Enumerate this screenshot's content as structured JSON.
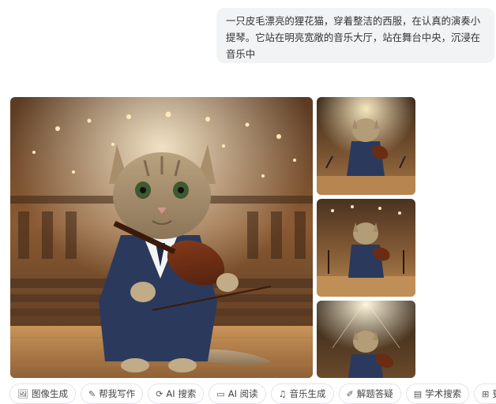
{
  "prompt": {
    "text": "一只皮毛漂亮的狸花猫，穿着整洁的西服，在认真的演奏小提琴。它站在明亮宽敞的音乐大厅，站在舞台中央，沉浸在音乐中"
  },
  "images": {
    "main": {
      "icon": "cat-violinist-concert-hall-image"
    },
    "thumbnails": [
      {
        "icon": "cat-violinist-stage-image"
      },
      {
        "icon": "cat-violinist-stage-image"
      },
      {
        "icon": "cat-violinist-stage-image"
      }
    ]
  },
  "tools": [
    {
      "label": "图像生成",
      "icon": "image-icon"
    },
    {
      "label": "帮我写作",
      "icon": "pen-icon"
    },
    {
      "label": "AI 搜索",
      "icon": "search-icon"
    },
    {
      "label": "AI 阅读",
      "icon": "book-icon"
    },
    {
      "label": "音乐生成",
      "icon": "music-icon"
    },
    {
      "label": "解题答疑",
      "icon": "pencil-icon"
    },
    {
      "label": "学术搜索",
      "icon": "scholar-icon"
    },
    {
      "label": "更多",
      "icon": "grid-icon"
    }
  ],
  "colors": {
    "bubble_bg": "#f2f3f5",
    "hall_warm": "#b07a43",
    "suit_navy": "#2b3a5c"
  }
}
